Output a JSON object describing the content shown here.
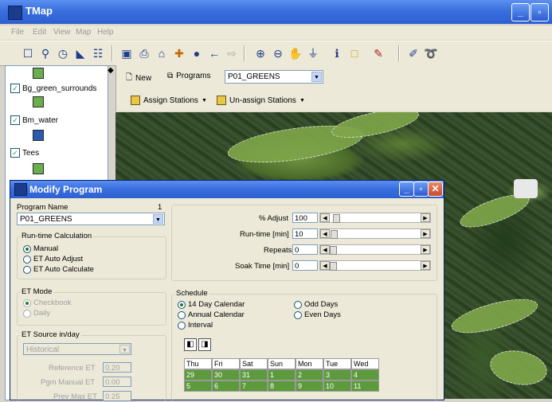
{
  "app": {
    "title": "TMap"
  },
  "menu": [
    "File",
    "Edit",
    "View",
    "Map",
    "Help"
  ],
  "layers": [
    {
      "label": "Bg_green_surrounds",
      "checked": true,
      "color": "#6aae4e"
    },
    {
      "label": "Bm_water",
      "checked": true,
      "color": "#2a5bb0"
    },
    {
      "label": "Tees",
      "checked": true,
      "color": "#6aae4e"
    }
  ],
  "layer_top_swatch_color": "#6aae4e",
  "program_toolbar": {
    "new_label": "New",
    "programs_label": "Programs",
    "program_select": "P01_GREENS",
    "assign_label": "Assign Stations",
    "unassign_label": "Un-assign Stations"
  },
  "dialog": {
    "title": "Modify Program",
    "program_name_label": "Program Name",
    "program_number": "1",
    "program_name_value": "P01_GREENS",
    "runtime_group_label": "Run-time Calculation",
    "runtime_options": [
      "Manual",
      "ET Auto Adjust",
      "ET Auto Calculate"
    ],
    "runtime_selected": "Manual",
    "et_mode_label": "ET Mode",
    "et_mode_options": [
      "Checkbook",
      "Daily"
    ],
    "et_source_label": "ET Source in/day",
    "et_source_value": "Historical",
    "reference_et_label": "Reference ET",
    "reference_et_value": "0.20",
    "pgm_manual_et_label": "Pgm Manual ET",
    "pgm_manual_et_value": "0.00",
    "prev_max_et_label": "Prev Max ET",
    "prev_max_et_value": "0.25",
    "adjust_label": "% Adjust",
    "adjust_value": "100",
    "runtime_label": "Run-time [min]",
    "runtime_value": "10",
    "repeats_label": "Repeats",
    "repeats_value": "0",
    "soak_label": "Soak Time [min]",
    "soak_value": "0",
    "schedule_label": "Schedule",
    "schedule_options_left": [
      "14 Day Calendar",
      "Annual Calendar",
      "Interval"
    ],
    "schedule_options_right": [
      "Odd Days",
      "Even Days"
    ],
    "schedule_selected": "14 Day Calendar",
    "calendar_headers": [
      "Thu",
      "Fri",
      "Sat",
      "Sun",
      "Mon",
      "Tue",
      "Wed"
    ],
    "calendar_rows": [
      [
        "29",
        "30",
        "31",
        "1",
        "2",
        "3",
        "4"
      ],
      [
        "5",
        "6",
        "7",
        "8",
        "9",
        "10",
        "11"
      ]
    ]
  }
}
